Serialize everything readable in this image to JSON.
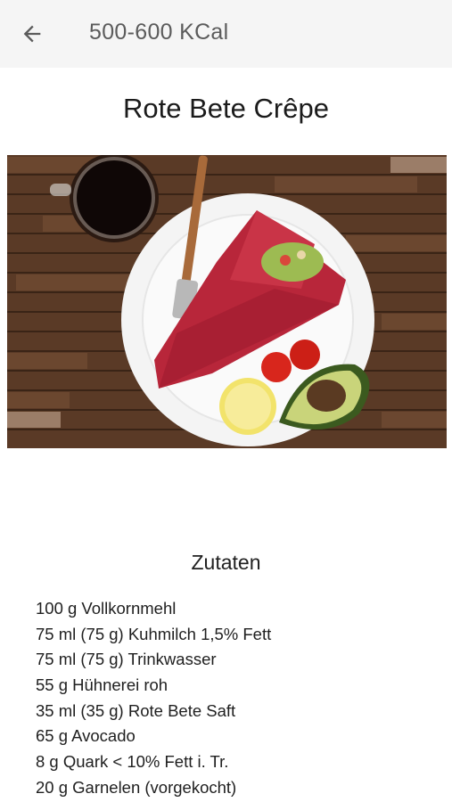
{
  "appbar": {
    "back_icon": "arrow-left-icon",
    "title": "500-600 KCal"
  },
  "recipe": {
    "title": "Rote Bete Crêpe",
    "image_icon": "recipe-photo"
  },
  "ingredients_section": {
    "title": "Zutaten",
    "items": [
      "100 g Vollkornmehl",
      "75 ml (75 g) Kuhmilch 1,5% Fett",
      "75 ml (75 g) Trinkwasser",
      "55 g Hühnerei roh",
      "35 ml (35 g) Rote Bete Saft",
      "65 g Avocado",
      "8 g Quark < 10% Fett i. Tr.",
      "20 g Garnelen (vorgekocht)"
    ]
  },
  "colors": {
    "appbar_bg": "#f5f5f5",
    "appbar_text": "#5b5b5b",
    "wood": "#5a3a26",
    "crepe": "#b8263a"
  }
}
